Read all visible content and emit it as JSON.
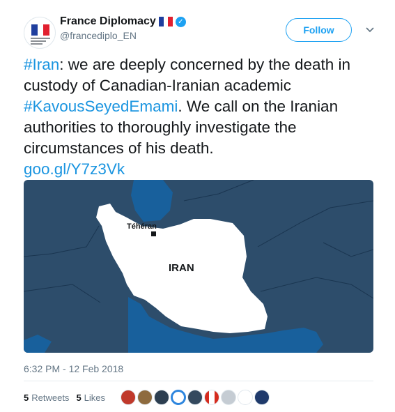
{
  "account": {
    "display_name": "France Diplomacy",
    "handle": "@francediplo_EN",
    "verified_icon": "verified-badge-icon",
    "colors": {
      "flag_blue": "#1f3f9e",
      "flag_white": "#ffffff",
      "flag_red": "#e1202f"
    }
  },
  "actions": {
    "follow_label": "Follow"
  },
  "tweet": {
    "hashtag_iran": "#Iran",
    "text_1": ": we are deeply concerned by the death in custody of Canadian-Iranian academic ",
    "hashtag_kavous": "#KavousSeyedEmami",
    "text_2": ". We call on the Iranian authorities to thoroughly investigate the circumstances of his death.",
    "link": "goo.gl/Y7z3Vk"
  },
  "map": {
    "country_label": "IRAN",
    "city_label": "Téhéran",
    "colors": {
      "land": "#2d4d6b",
      "water": "#18609c",
      "country": "#ffffff"
    }
  },
  "timestamp": "6:32 PM - 12 Feb 2018",
  "stats": {
    "retweets_count": "5",
    "retweets_label": "Retweets",
    "likes_count": "5",
    "likes_label": "Likes"
  },
  "accent_color": "#1da1f2"
}
